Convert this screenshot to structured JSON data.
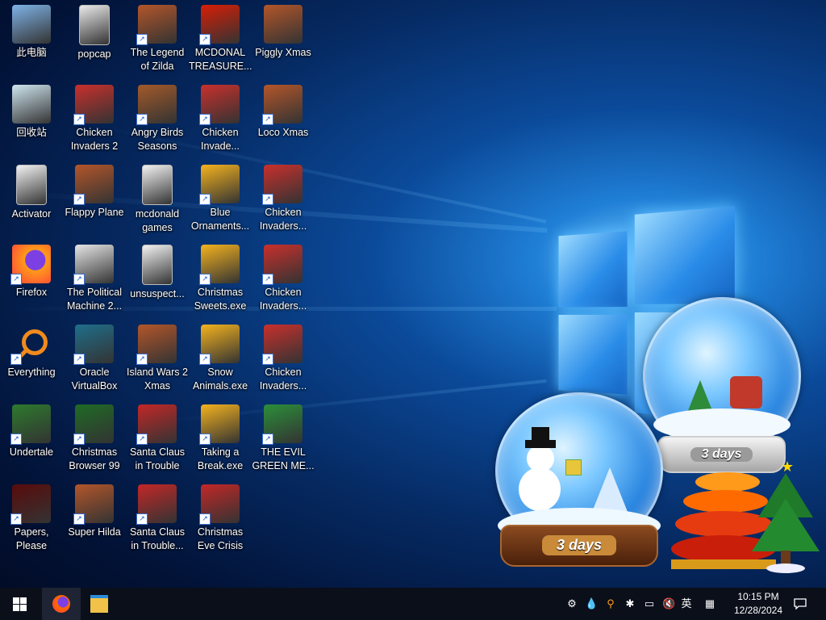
{
  "desktop": {
    "icons": [
      {
        "label": "此电脑",
        "icon": "computer-icon",
        "shortcut": false
      },
      {
        "label": "popcap",
        "icon": "folder-icon",
        "shortcut": false
      },
      {
        "label": "The Legend of Zilda",
        "icon": "game-icon",
        "shortcut": true
      },
      {
        "label": "MCDONAL TREASURE...",
        "icon": "mcdonalds-icon",
        "shortcut": true
      },
      {
        "label": "Piggly Xmas",
        "icon": "game-icon",
        "shortcut": false
      },
      {
        "label": "回收站",
        "icon": "recycle-bin-icon",
        "shortcut": false
      },
      {
        "label": "Chicken Invaders 2",
        "icon": "chicken-icon",
        "shortcut": true
      },
      {
        "label": "Angry Birds Seasons",
        "icon": "angry-birds-icon",
        "shortcut": true
      },
      {
        "label": "Chicken Invade...",
        "icon": "chicken-icon",
        "shortcut": true
      },
      {
        "label": "Loco Xmas",
        "icon": "game-icon",
        "shortcut": true
      },
      {
        "label": "Activator",
        "icon": "file-icon",
        "shortcut": false
      },
      {
        "label": "Flappy Plane",
        "icon": "game-icon",
        "shortcut": true
      },
      {
        "label": "mcdonald games",
        "icon": "file-icon",
        "shortcut": false
      },
      {
        "label": "Blue Ornaments...",
        "icon": "puzzle-icon",
        "shortcut": true
      },
      {
        "label": "Chicken Invaders...",
        "icon": "chicken-icon",
        "shortcut": true
      },
      {
        "label": "Firefox",
        "icon": "firefox-icon",
        "shortcut": true
      },
      {
        "label": "The Political Machine 2...",
        "icon": "political-icon",
        "shortcut": true
      },
      {
        "label": "unsuspect...",
        "icon": "file-icon",
        "shortcut": false
      },
      {
        "label": "Christmas Sweets.exe",
        "icon": "puzzle-icon",
        "shortcut": true
      },
      {
        "label": "Chicken Invaders...",
        "icon": "chicken-icon",
        "shortcut": true
      },
      {
        "label": "Everything",
        "icon": "search-icon",
        "shortcut": true
      },
      {
        "label": "Oracle VirtualBox",
        "icon": "virtualbox-icon",
        "shortcut": true
      },
      {
        "label": "Island Wars 2 Xmas",
        "icon": "game-icon",
        "shortcut": true
      },
      {
        "label": "Snow Animals.exe",
        "icon": "puzzle-icon",
        "shortcut": true
      },
      {
        "label": "Chicken Invaders...",
        "icon": "chicken-icon",
        "shortcut": true
      },
      {
        "label": "Undertale",
        "icon": "undertale-icon",
        "shortcut": true
      },
      {
        "label": "Christmas Browser 99",
        "icon": "tree-icon",
        "shortcut": true
      },
      {
        "label": "Santa Claus in Trouble",
        "icon": "santa-icon",
        "shortcut": true
      },
      {
        "label": "Taking a Break.exe",
        "icon": "puzzle-icon",
        "shortcut": true
      },
      {
        "label": "THE EVIL GREEN ME...",
        "icon": "messenger-icon",
        "shortcut": true
      },
      {
        "label": "Papers, Please",
        "icon": "papers-icon",
        "shortcut": true
      },
      {
        "label": "Super Hilda",
        "icon": "game-icon",
        "shortcut": true
      },
      {
        "label": "Santa Claus in Trouble...",
        "icon": "santa-icon",
        "shortcut": true
      },
      {
        "label": "Christmas Eve Crisis",
        "icon": "santa-icon",
        "shortcut": true
      }
    ]
  },
  "widgets": {
    "globe_left_label": "3 days",
    "globe_right_label": "3 days"
  },
  "taskbar": {
    "start": "windows-start-icon",
    "pinned": [
      "firefox-icon",
      "file-explorer-icon"
    ],
    "tray": {
      "ime": "英",
      "time": "10:15 PM",
      "date": "12/28/2024"
    }
  },
  "colors": {
    "taskbar": "#0b0f1a",
    "accent": "#1f7fd6"
  }
}
